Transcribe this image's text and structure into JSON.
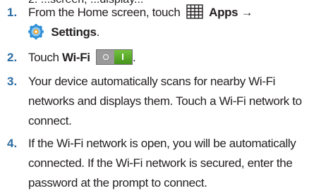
{
  "clipped_top_text": "2.  ...screen, ...display...",
  "steps": [
    {
      "number": "1.",
      "lines": {
        "a": "From the Home screen, touch",
        "apps": "Apps",
        "arrow": "→",
        "settings": "Settings",
        "period": "."
      },
      "icons": [
        "apps-grid-icon",
        "settings-gear-icon"
      ]
    },
    {
      "number": "2.",
      "lines": {
        "a": "Touch",
        "wifi": "Wi-Fi",
        "period": "."
      },
      "icons": [
        "wifi-toggle-icon"
      ]
    },
    {
      "number": "3.",
      "lines": [
        "Your device automatically scans for nearby Wi-Fi",
        "networks and displays them. Touch a Wi-Fi network to",
        "connect."
      ]
    },
    {
      "number": "4.",
      "lines": [
        "If the Wi-Fi network is open, you will be automatically",
        "connected. If the Wi-Fi network is secured, enter the",
        "password at the prompt to connect."
      ]
    }
  ],
  "colors": {
    "step_number": "#2b6ca3",
    "body_text": "#231f20",
    "toggle_on": "#5aab2a",
    "gear_blue": "#2f8fd6",
    "gear_orange": "#f5a623"
  }
}
